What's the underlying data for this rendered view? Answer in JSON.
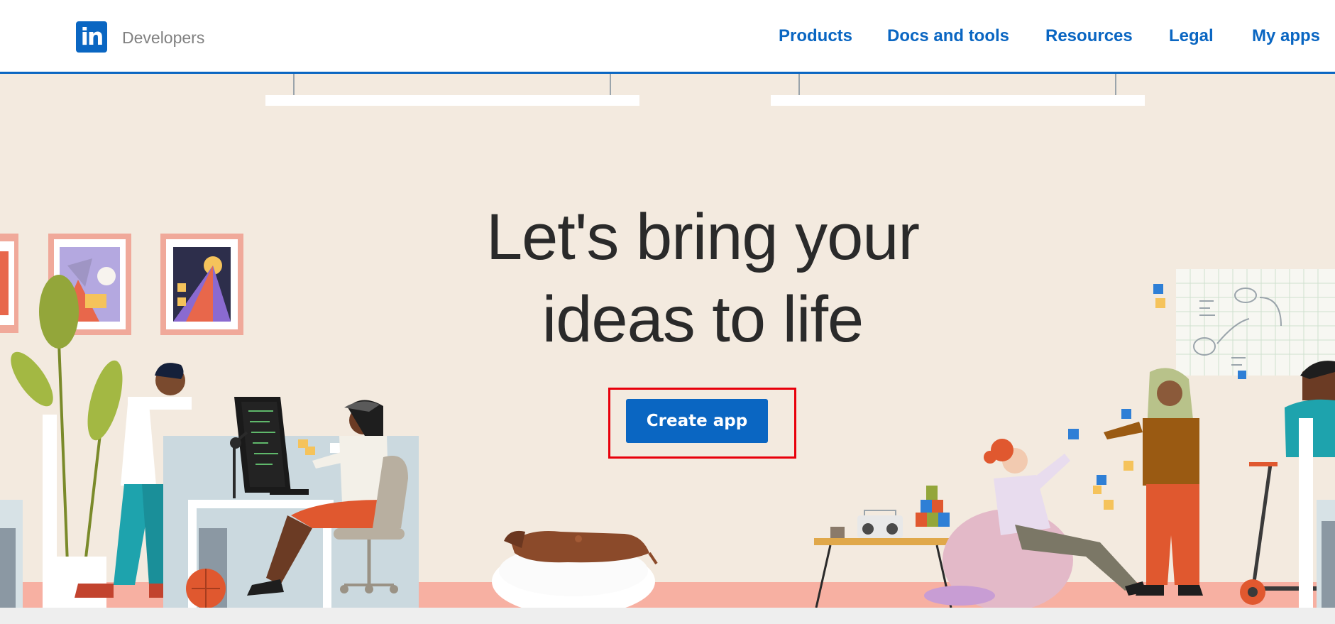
{
  "header": {
    "logo_text": "in",
    "brand": "Developers",
    "nav": {
      "products": "Products",
      "docs": "Docs and tools",
      "resources": "Resources",
      "legal": "Legal",
      "my_apps": "My apps"
    }
  },
  "hero": {
    "headline_line1": "Let's bring your",
    "headline_line2": "ideas to life",
    "cta_label": "Create app"
  },
  "colors": {
    "brand_blue": "#0a66c2",
    "hero_bg": "#f3eadf",
    "highlight_red": "#e8000b"
  }
}
